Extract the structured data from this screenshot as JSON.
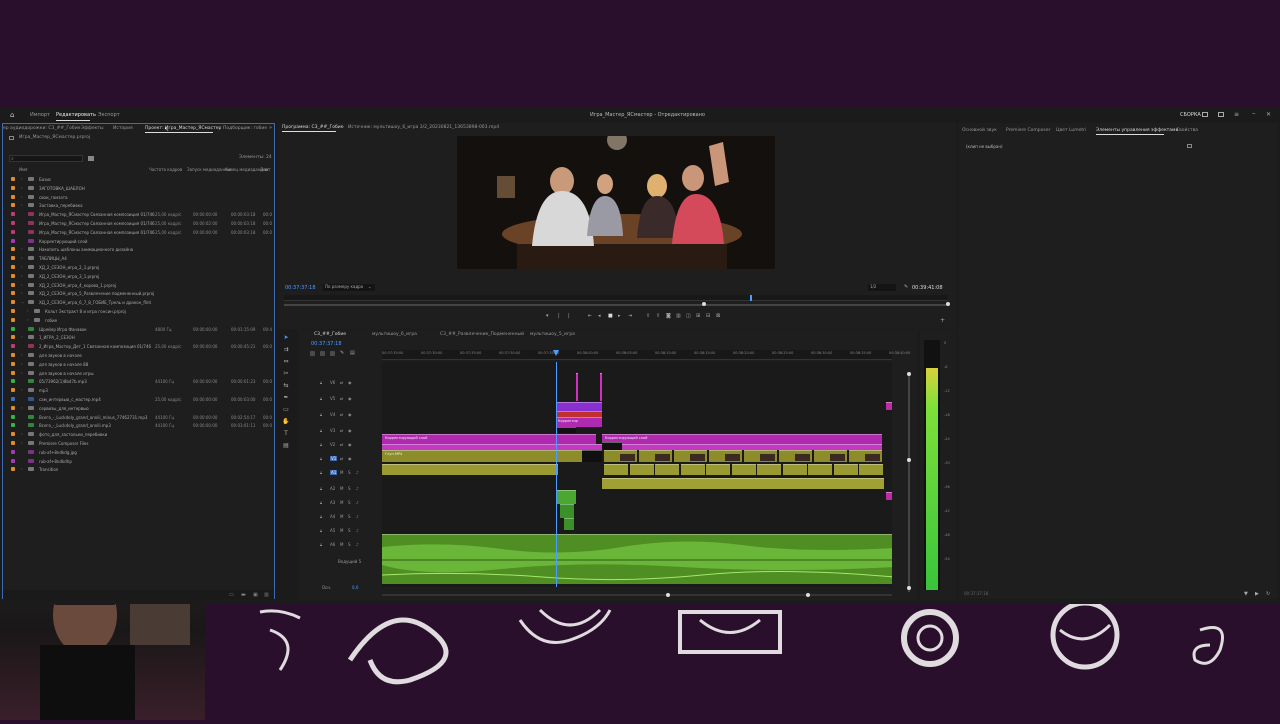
{
  "menu": {
    "tabs": [
      "Импорт",
      "Редактировать",
      "Экспорт"
    ],
    "title": "Игра_Мастер_ЯСмастер - Отредактировано",
    "right_label": "СБОРКА"
  },
  "left": {
    "tabs": [
      "ер аудиодорожки: С3_##_Гобие",
      "Эффекты",
      "История",
      "Проект: Игра_Мастер_ЯСмастер",
      "Подборщик: гобие"
    ],
    "project_file": "Игра_Мастер_ЯСмастер.prproj",
    "items_count": "Элементы: 24",
    "search_placeholder": "",
    "columns": [
      "Имя",
      "Частота кадров",
      "Запуск медиаданных",
      "Конец медиаданных",
      "Длит"
    ],
    "rows": [
      {
        "name": "Базис",
        "color": "#e08b2e",
        "folder": true,
        "tri": "›"
      },
      {
        "name": "ЗАГОТОВКА_ШАБЛОН",
        "color": "#e08b2e",
        "folder": true,
        "tri": "›"
      },
      {
        "name": "свои_гамзата",
        "color": "#e08b2e",
        "folder": true,
        "tri": "›"
      },
      {
        "name": "Заставка_перебивка",
        "color": "#e08b2e",
        "folder": true,
        "tri": "›"
      },
      {
        "name": "Игра_Мастер_ЯСмастер Связанная композиция 01/746",
        "color": "#c03a7a",
        "fps": "25,00 кадр/с",
        "start": "00:00:00:00",
        "end": "00:00:03:18",
        "dur": "00:0"
      },
      {
        "name": "Игра_Мастер_ЯСмастер Связанная композиция 01/746",
        "color": "#c03a7a",
        "fps": "25,00 кадр/с",
        "start": "00:00:02:00",
        "end": "00:00:03:18",
        "dur": "00:0"
      },
      {
        "name": "Игра_Мастер_ЯСмастер Связанная композиция 01/746",
        "color": "#c03a7a",
        "fps": "25,00 кадр/с",
        "start": "00:00:00:00",
        "end": "00:00:03:18",
        "dur": "00:0"
      },
      {
        "name": "Корректирующий слой",
        "color": "#a33ab5"
      },
      {
        "name": "Накопить шаблоны анимационного дизайна",
        "color": "#e08b2e",
        "folder": true,
        "tri": "›"
      },
      {
        "name": "ТАБЛИЦЫ_А4",
        "color": "#e08b2e",
        "folder": true,
        "tri": "›"
      },
      {
        "name": "ХД_2_СЕЗОН_игра_2_1.prproj",
        "color": "#e08b2e",
        "folder": true,
        "tri": "›"
      },
      {
        "name": "ХД_2_СЕЗОН_игра_3_1.prproj",
        "color": "#e08b2e",
        "folder": true,
        "tri": "›"
      },
      {
        "name": "ХД_2_СЕЗОН_игра_4_корова_1.prproj",
        "color": "#e08b2e",
        "folder": true,
        "tri": "›"
      },
      {
        "name": "ХД_2_СЕЗОН_игра_5_Развлечение подмененный.prproj",
        "color": "#e08b2e",
        "folder": true,
        "tri": "›"
      },
      {
        "name": "ХД_2_СЕЗОН_игра_6_7_8_ГОБИЕ_Трель и дракон_flint",
        "color": "#e08b2e",
        "folder": true,
        "tri": "⌄"
      },
      {
        "name": "Кольт Экстракт 8 и игра гонсин.prproj",
        "color": "#e08b2e",
        "folder": true,
        "tri": "›",
        "indent": true
      },
      {
        "name": "гобие",
        "color": "#e08b2e",
        "folder": true,
        "tri": "›",
        "indent": true
      },
      {
        "name": "Шрейер Игра Фанавок",
        "color": "#3bb04a",
        "fps": "4800 Гц",
        "start": "00:00:00:00",
        "end": "00:01:15:09",
        "dur": "00:4"
      },
      {
        "name": "1_ИГРА_2_СЕЗОН",
        "color": "#e08b2e",
        "folder": true,
        "tri": "›"
      },
      {
        "name": "2_Игра_Мастер_Дет_1 Связанная композиция 01/746",
        "color": "#c03a7a",
        "fps": "25,00 кадр/с",
        "start": "00:00:00:00",
        "end": "00:00:45:21",
        "dur": "00:0"
      },
      {
        "name": "для звуков в начале",
        "color": "#e08b2e",
        "folder": true,
        "tri": "›"
      },
      {
        "name": "для звуков в начале 88",
        "color": "#e08b2e",
        "folder": true,
        "tri": "›"
      },
      {
        "name": "для звуков в начале игры",
        "color": "#e08b2e",
        "folder": true,
        "tri": "›"
      },
      {
        "name": "05/73962(1)8bd7b.mp3",
        "color": "#3bb04a",
        "fps": "44100 Гц",
        "start": "00:00:00:00",
        "end": "00:00:01:23",
        "dur": "00:0"
      },
      {
        "name": "mp3",
        "color": "#e08b2e",
        "folder": true,
        "tri": "›"
      },
      {
        "name": "сам_интервью_с_мастер.mp4",
        "color": "#3a6fc2",
        "fps": "25,00 кадр/с",
        "start": "00:00:00:00",
        "end": "00:00:03:00",
        "dur": "00:0"
      },
      {
        "name": "сервизы_для_интервью",
        "color": "#e08b2e",
        "folder": true,
        "tri": "›"
      },
      {
        "name": "Всего_-_Luckdoly_grand_annili_minus_77462731.mp3",
        "color": "#3bb04a",
        "fps": "44100 Гц",
        "start": "00:00:00:00",
        "end": "00:02:54:17",
        "dur": "00:0"
      },
      {
        "name": "Всего_-_Luckdoly_grand_annili.mp3",
        "color": "#3bb04a",
        "fps": "44100 Гц",
        "start": "00:00:00:00",
        "end": "00:03:01:11",
        "dur": "00:0"
      },
      {
        "name": "фото_для_застольки_перебивки",
        "color": "#e08b2e",
        "folder": true,
        "tri": "›"
      },
      {
        "name": "Premiere Composer Files",
        "color": "#e08b2e",
        "folder": true,
        "tri": "›"
      },
      {
        "name": "rub-af+8ndkdg.jpg",
        "color": "#a33ab5"
      },
      {
        "name": "rub-af+8ndkdhp",
        "color": "#a33ab5"
      },
      {
        "name": "Transition",
        "color": "#e08b2e",
        "folder": true,
        "tri": "›"
      }
    ]
  },
  "program": {
    "tabs": [
      "Программа: С3_##_Гобие",
      "Источник: мультишоу_6_игра 3/2_20230821_13653898-003.mp4"
    ],
    "timecode": "00:37:37:18",
    "fit_label": "По размеру кадра",
    "quality": "1/2",
    "duration": "00:39:41:08"
  },
  "timeline": {
    "tabs": [
      "С3_##_Гобие",
      "мультишоу_6_игра",
      "С3_##_Развлечение_Подмененный",
      "мультишоу_5_игра"
    ],
    "timecode": "00:37:37:18",
    "ruler": [
      "00:37:35:00",
      "00:37:30:00",
      "00:37:35:00",
      "00:37:30:00",
      "00:37:35:00",
      "00:38:00:00",
      "00:38:05:00",
      "00:38:10:00",
      "00:38:15:00",
      "00:38:20:00",
      "00:38:25:00",
      "00:38:30:00",
      "00:38:35:00",
      "00:38:40:00"
    ],
    "video_tracks": [
      "V6",
      "V5",
      "V4",
      "V3",
      "V2",
      "V1"
    ],
    "audio_tracks": [
      "A1",
      "A2",
      "A3",
      "A4",
      "A5",
      "A6"
    ],
    "mix_label": "Ведущий 5",
    "adj_clip_1": "Корректирующий слой",
    "adj_clip_2": "Корректирующий слой",
    "adj_clip_3": "Корректирующий слой",
    "adj_clip_small": "Корректир",
    "v1_clip": "Глуп.MP4",
    "master_label": "Осн.",
    "master_value": "0,0"
  },
  "meter": {
    "scale": [
      "0",
      "-6",
      "-12",
      "-18",
      "-24",
      "-30",
      "-36",
      "-42",
      "-48",
      "-54"
    ]
  },
  "right": {
    "tabs": [
      "Основной звук",
      "Premiere Composer",
      "Цвет Lumetri",
      "Элементы управления эффектами",
      "Свойства"
    ],
    "no_clip": "(клип не выбран)",
    "footer_tc": "00:37:37:18"
  }
}
